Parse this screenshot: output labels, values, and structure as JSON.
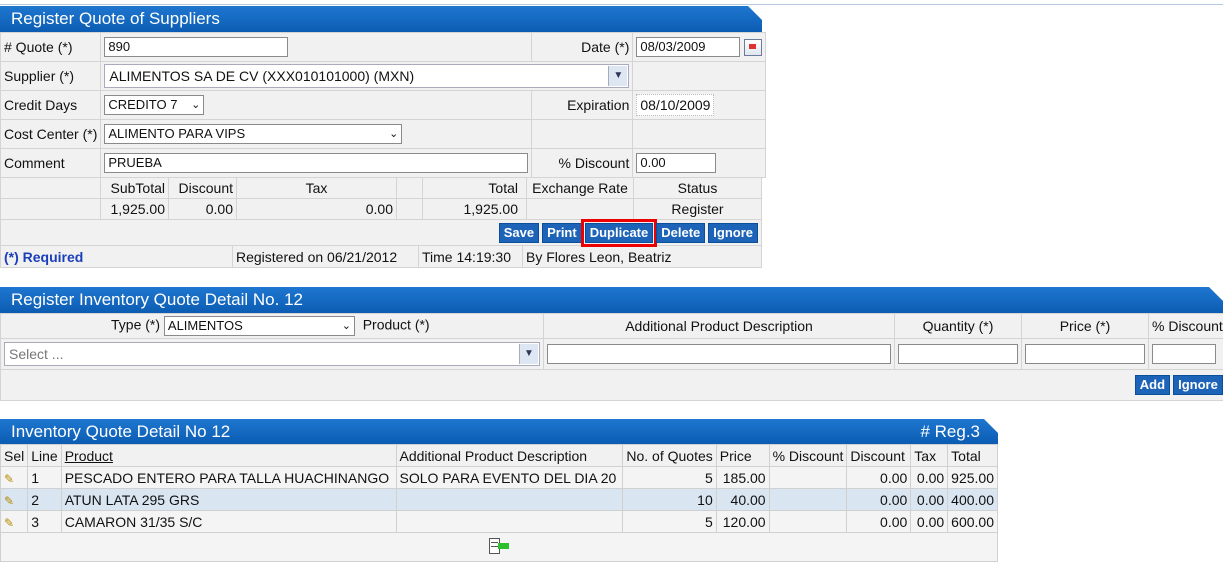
{
  "quote_panel": {
    "title": "Register Quote of Suppliers",
    "quote_label": "# Quote (*)",
    "quote_value": "890",
    "date_label": "Date (*)",
    "date_value": "08/03/2009",
    "supplier_label": "Supplier (*)",
    "supplier_value": "ALIMENTOS SA DE CV (XXX010101000) (MXN)",
    "credit_days_label": "Credit Days",
    "credit_days_value": "CREDITO 7",
    "expiration_label": "Expiration",
    "expiration_value": "08/10/2009",
    "cost_center_label": "Cost Center (*)",
    "cost_center_value": "ALIMENTO PARA VIPS",
    "comment_label": "Comment",
    "comment_value": "PRUEBA",
    "discount_label": "% Discount",
    "discount_value": "0.00",
    "summary_headers": {
      "subtotal": "SubTotal",
      "discount": "Discount",
      "tax": "Tax",
      "total": "Total",
      "exchange_rate": "Exchange Rate",
      "status": "Status"
    },
    "summary_values": {
      "subtotal": "1,925.00",
      "discount": "0.00",
      "tax": "0.00",
      "total": "1,925.00",
      "exchange_rate": "",
      "status": "Register"
    },
    "buttons": {
      "save": "Save",
      "print": "Print",
      "duplicate": "Duplicate",
      "delete": "Delete",
      "ignore": "Ignore"
    },
    "footer": {
      "required": "(*) Required",
      "registered": "Registered on 06/21/2012",
      "time": "Time 14:19:30",
      "by": "By Flores Leon, Beatriz"
    }
  },
  "detail_panel": {
    "title": "Register Inventory Quote Detail No. 12",
    "type_label": "Type (*)",
    "type_value": "ALIMENTOS",
    "product_label": "Product (*)",
    "product_placeholder": "Select ...",
    "addl_desc_label": "Additional Product Description",
    "quantity_label": "Quantity (*)",
    "price_label": "Price (*)",
    "discount_label": "% Discount",
    "buttons": {
      "add": "Add",
      "ignore": "Ignore"
    }
  },
  "list_panel": {
    "title": "Inventory Quote Detail No 12",
    "reg_count": "# Reg.3",
    "headers": [
      "Sel",
      "Line",
      "Product",
      "Additional Product Description",
      "No. of Quotes",
      "Price",
      "% Discount",
      "Discount",
      "Tax",
      "Total"
    ],
    "rows": [
      {
        "line": "1",
        "product": "PESCADO ENTERO PARA TALLA HUACHINANGO",
        "desc": "SOLO PARA EVENTO DEL DIA 20",
        "quotes": "5",
        "price": "185.00",
        "pdisc": "",
        "disc": "0.00",
        "tax": "0.00",
        "total": "925.00"
      },
      {
        "line": "2",
        "product": "ATUN LATA 295 GRS",
        "desc": "",
        "quotes": "10",
        "price": "40.00",
        "pdisc": "",
        "disc": "0.00",
        "tax": "0.00",
        "total": "400.00"
      },
      {
        "line": "3",
        "product": "CAMARON 31/35 S/C",
        "desc": "",
        "quotes": "5",
        "price": "120.00",
        "pdisc": "",
        "disc": "0.00",
        "tax": "0.00",
        "total": "600.00"
      }
    ]
  }
}
